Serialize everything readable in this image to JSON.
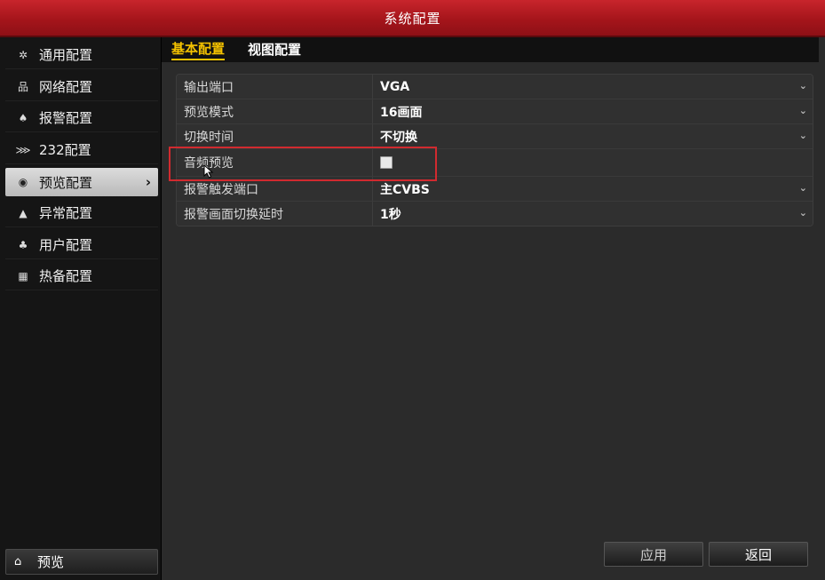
{
  "window": {
    "title": "系统配置"
  },
  "sidebar": {
    "items": [
      {
        "label": "通用配置",
        "icon": "gear-icon"
      },
      {
        "label": "网络配置",
        "icon": "network-icon"
      },
      {
        "label": "报警配置",
        "icon": "alarm-icon"
      },
      {
        "label": "232配置",
        "icon": "serial-port-icon"
      },
      {
        "label": "预览配置",
        "icon": "eye-icon",
        "active": true
      },
      {
        "label": "异常配置",
        "icon": "warning-icon"
      },
      {
        "label": "用户配置",
        "icon": "users-icon"
      },
      {
        "label": "热备配置",
        "icon": "backup-icon"
      }
    ],
    "bottom": {
      "label": "预览",
      "icon": "home-icon"
    }
  },
  "tabs": [
    {
      "label": "基本配置",
      "active": true
    },
    {
      "label": "视图配置",
      "active": false
    }
  ],
  "settings": [
    {
      "label": "输出端口",
      "value": "VGA",
      "type": "select"
    },
    {
      "label": "预览模式",
      "value": "16画面",
      "type": "select"
    },
    {
      "label": "切换时间",
      "value": "不切换",
      "type": "select"
    },
    {
      "label": "音频预览",
      "value": "",
      "type": "checkbox",
      "checked": false
    },
    {
      "label": "报警触发端口",
      "value": "主CVBS",
      "type": "select"
    },
    {
      "label": "报警画面切换延时",
      "value": "1秒",
      "type": "select"
    }
  ],
  "buttons": {
    "apply": "应用",
    "back": "返回"
  },
  "colors": {
    "titlebar": "#b81c22",
    "active_tab": "#f4c200",
    "highlight": "#d12a2f"
  }
}
